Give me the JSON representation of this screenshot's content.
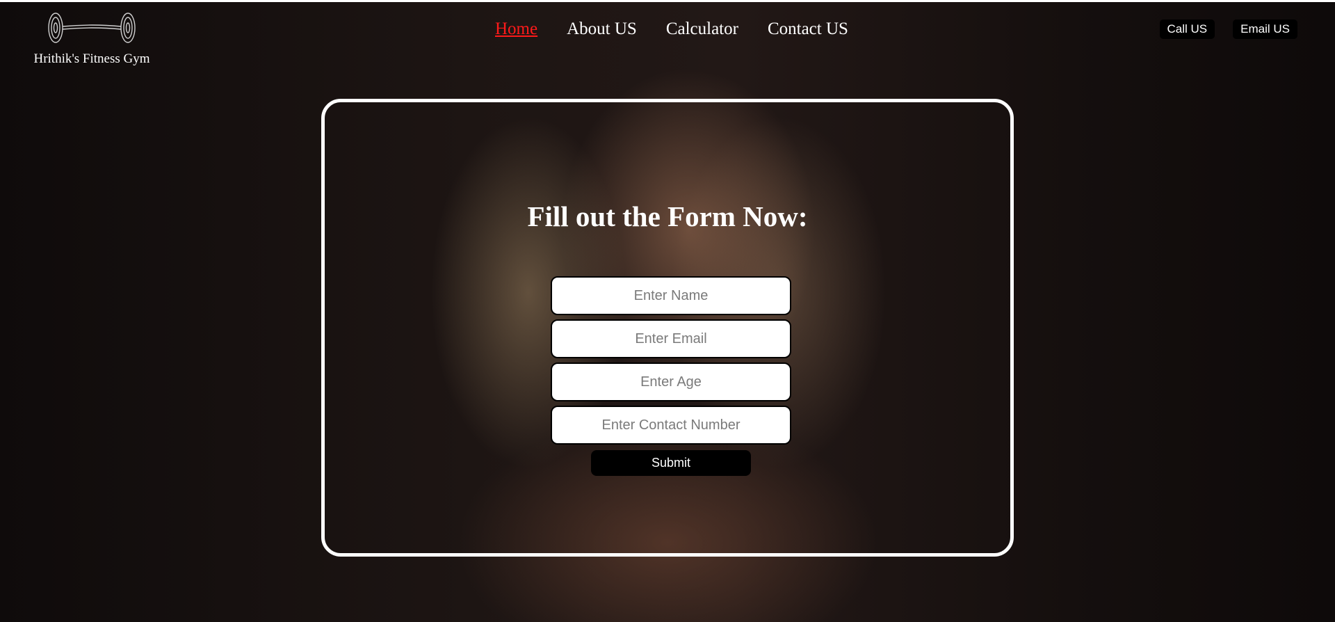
{
  "header": {
    "logo_icon": "barbell-icon",
    "brand_name": "Hrithik's Fitness Gym",
    "nav": [
      {
        "label": "Home",
        "active": true
      },
      {
        "label": "About US",
        "active": false
      },
      {
        "label": "Calculator",
        "active": false
      },
      {
        "label": "Contact US",
        "active": false
      }
    ],
    "buttons": {
      "call": "Call US",
      "email": "Email US"
    }
  },
  "form": {
    "title": "Fill out the Form Now:",
    "fields": {
      "name": {
        "placeholder": "Enter Name",
        "value": ""
      },
      "email": {
        "placeholder": "Enter Email",
        "value": ""
      },
      "age": {
        "placeholder": "Enter Age",
        "value": ""
      },
      "contact": {
        "placeholder": "Enter Contact Number",
        "value": ""
      }
    },
    "submit_label": "Submit"
  },
  "colors": {
    "active_nav": "#ff1a1a",
    "text": "#ffffff",
    "button_bg": "#000000",
    "card_border": "#ffffff"
  }
}
